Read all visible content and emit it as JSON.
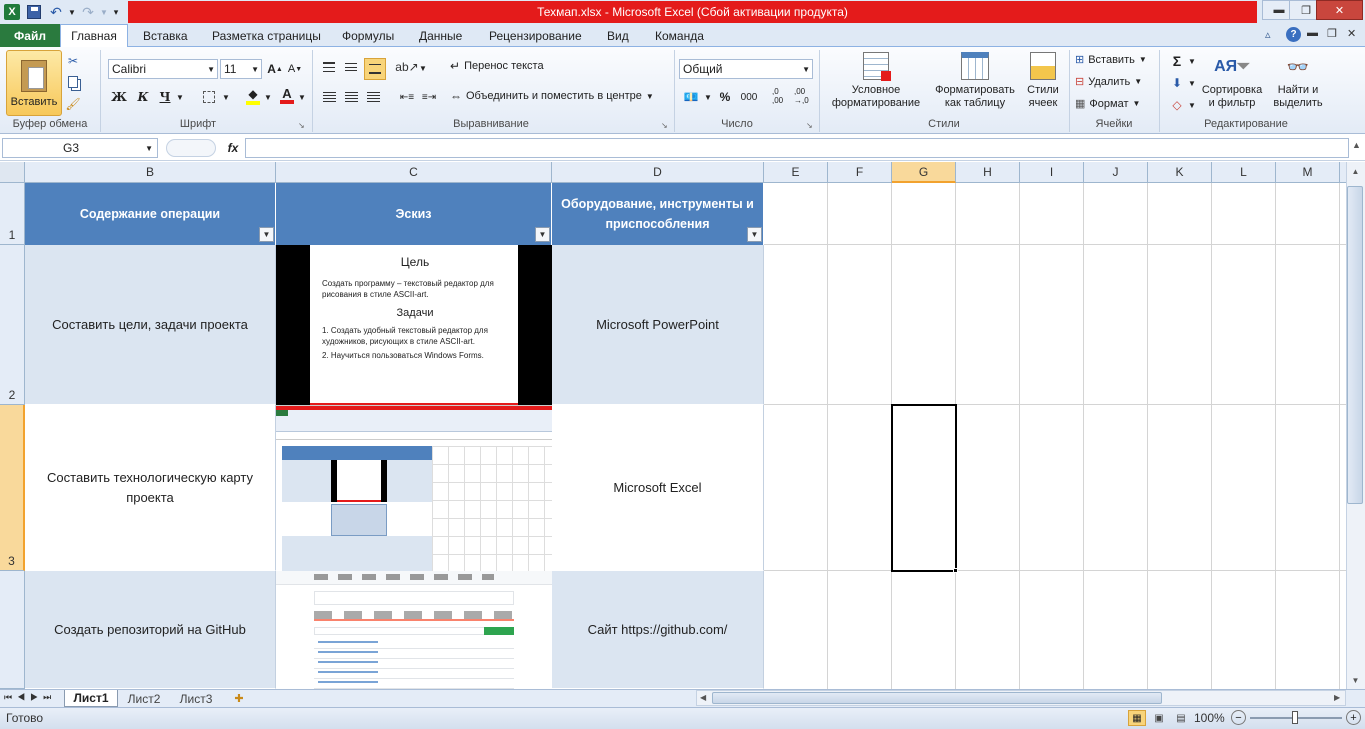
{
  "window": {
    "title": "Техмап.xlsx  -  Microsoft Excel (Сбой активации продукта)",
    "qat_undo_icon": "undo-icon",
    "qat_redo_icon": "redo-icon",
    "min_label": "▬",
    "max_label": "❐",
    "close_label": "✕"
  },
  "tabs": [
    "Файл",
    "Главная",
    "Вставка",
    "Разметка страницы",
    "Формулы",
    "Данные",
    "Рецензирование",
    "Вид",
    "Команда"
  ],
  "ribbon": {
    "clipboard": {
      "paste": "Вставить",
      "group": "Буфер обмена"
    },
    "font": {
      "name": "Calibri",
      "size": "11",
      "bold": "Ж",
      "italic": "К",
      "underline": "Ч",
      "grow": "A",
      "shrink": "A",
      "color_letter": "A",
      "group": "Шрифт"
    },
    "alignment": {
      "wrap": "Перенос текста",
      "merge": "Объединить и поместить в центре",
      "group": "Выравнивание"
    },
    "number": {
      "format": "Общий",
      "percent": "%",
      "thousands": "000",
      "inc_decimal": ",0\n,00",
      "dec_decimal": ",00\n→,0",
      "group": "Число"
    },
    "styles": {
      "conditional": "Условное\nформатирование",
      "as_table": "Форматировать\nкак таблицу",
      "cell_styles": "Стили\nячеек",
      "group": "Стили"
    },
    "cells": {
      "insert": "Вставить",
      "delete": "Удалить",
      "format": "Формат",
      "group": "Ячейки"
    },
    "editing": {
      "sort": "Сортировка\nи фильтр",
      "find": "Найти и\nвыделить",
      "group": "Редактирование"
    }
  },
  "formula_bar": {
    "name_box": "G3",
    "fx": "fx",
    "value": ""
  },
  "columns": [
    "B",
    "C",
    "D",
    "E",
    "F",
    "G",
    "H",
    "I",
    "J",
    "K",
    "L",
    "M"
  ],
  "rows": [
    "1",
    "2",
    "3"
  ],
  "table": {
    "headers": [
      "Содержание операции",
      "Эскиз",
      "Оборудование, инструменты и приспособления"
    ],
    "rows": [
      {
        "operation": "Составить цели, задачи проекта",
        "equipment": "Microsoft PowerPoint"
      },
      {
        "operation": "Составить технологическую карту проекта",
        "equipment": "Microsoft Excel"
      },
      {
        "operation": "Создать репозиторий на GitHub",
        "equipment": "Сайт https://github.com/"
      }
    ]
  },
  "slide": {
    "title": "Цель",
    "goal": "Создать программу – текстовый редактор для рисования в стиле ASCII-art.",
    "tasks_title": "Задачи",
    "task1": "1.  Создать удобный текстовый редактор для художников, рисующих в стиле ASCII-art.",
    "task2": "2.  Научиться пользоваться Windows Forms."
  },
  "sheets": [
    "Лист1",
    "Лист2",
    "Лист3"
  ],
  "status": {
    "ready": "Готово",
    "zoom": "100%"
  }
}
